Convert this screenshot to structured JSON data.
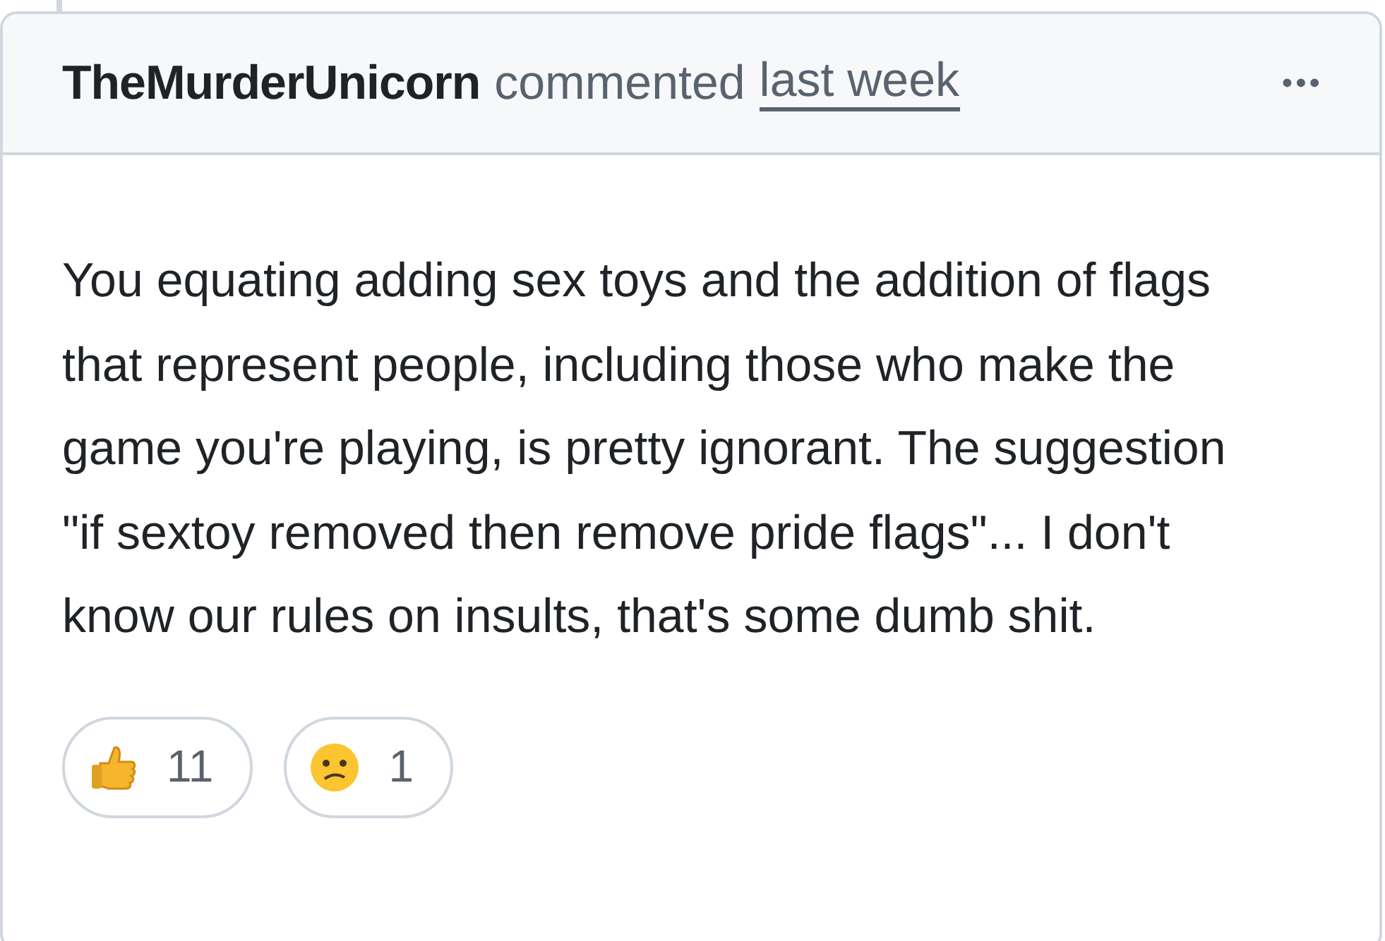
{
  "comment": {
    "author": "TheMurderUnicorn",
    "action": "commented",
    "time": "last week",
    "menu": "•••",
    "body": "You equating adding sex toys and the addition of flags that represent people, including those who make the game you're playing, is pretty ignorant. The suggestion \"if sextoy removed then remove pride flags\"... I don't know our rules on insults, that's some dumb shit.",
    "reactions": [
      {
        "kind": "thumbs_up",
        "count": "11"
      },
      {
        "kind": "confused",
        "count": "1"
      }
    ]
  }
}
